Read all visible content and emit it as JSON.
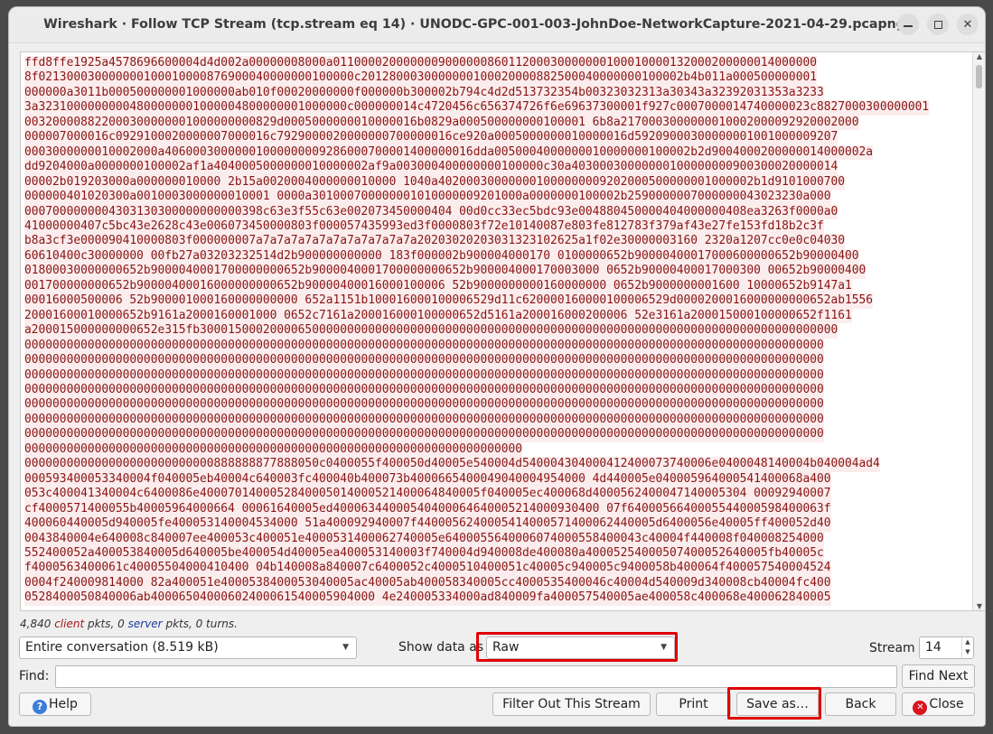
{
  "window": {
    "title": "Wireshark · Follow TCP Stream (tcp.stream eq 14) · UNODC-GPC-001-003-JohnDoe-NetworkCapture-2021-04-29.pcapng"
  },
  "stream": {
    "lines": [
      "ffd8ffe1925a4578696600004d4d002a00000008000a011000020000000900000086011200030000000100010000132000200000014000000",
      "8f021300030000000100010000876900040000000100000c2012800030000000100020000882500040000000100002b4b011a000500000001",
      "000000a3011b000500000001000000ab010f00020000000f000000b300002b794c4d2d513732354b00323032313a30343a32392031353a3233",
      "3a32310000000004800000001000004800000001000000c000000014c4720456c656374726f6e69637300001f927c0007000014740000023c8827000300000001",
      "003200008822000300000001000000000829d0005000000010000016b0829a000500000000100001 6b8a2170003000000010002000092920002000",
      "000007000016c0929100020000007000016c7929000020000000700000016ce920a0005000000010000016d59209000300000001001000009207",
      "0003000000010002000a40600030000001000000009286000700001400000016dda0050004000000010000000100002b2d9004000200000014000002a",
      "dd9204000a0000000100002af1a4040005000000010000002af9a003000400000000100000c30a40300030000000100000000900300020000014",
      "00002b019203000a000000010000 2b15a0020004000000010000 1040a402000300000001000000009202000500000001000002b1d9101000700",
      "000000401020300a0010003000000010001 0000a301000700000001010000009201000a0000000100002b2590000007000000043023230a000",
      "0007000000004303130300000000000398c63e3f55c63e002073450000404 00d0cc33ec5bdc93e004880450000404000000408ea3263f0000a0",
      "41000000407c5bc43e2628c43e006073450000803f000057435993ed3f0000803f72e10140087e803fe812783f379af43e27fe153fd18b2c3f",
      "b8a3cf3e000090410000803f000000007a7a7a7a7a7a7a7a7a7a7a7a20203020203031323102625a1f02e30000003160 2320a1207cc0e0c04030",
      "60610400c30000000 00fb27a03203232514d2b900000000000 183f000002b900004000170 0100000652b90000400017000600000652b90000400",
      "01800030000000652b9000040001700000000652b9000040001700000000652b900004000170003000 0652b90000400017000300 00652b90000400",
      "001700000000652b90000400016000000000652b90000400016000100006 52b9000000000160000000 0652b9000000001600 10000652b9147a1",
      "00016000500006 52b900001000160000000000 652a1151b100016000100006529d11c620000160000100006529d0000200016000000000652ab1556",
      "20001600010000652b9161a2000160001000 0652c7161a200016000100000652d5161a200016000200006 52e3161a200015000100000652f1161",
      "a200015000000000652e315fb3000150002000065000000000000000000000000000000000000000000000000000000000000000000000000000",
      "000000000000000000000000000000000000000000000000000000000000000000000000000000000000000000000000000000000000000000",
      "000000000000000000000000000000000000000000000000000000000000000000000000000000000000000000000000000000000000000000",
      "000000000000000000000000000000000000000000000000000000000000000000000000000000000000000000000000000000000000000000",
      "000000000000000000000000000000000000000000000000000000000000000000000000000000000000000000000000000000000000000000",
      "000000000000000000000000000000000000000000000000000000000000000000000000000000000000000000000000000000000000000000",
      "000000000000000000000000000000000000000000000000000000000000000000000000000000000000000000000000000000000000000000",
      "000000000000000000000000000000000000000000000000000000000000000000000000000000000000000000000000000000000000000000",
      "00000000000000000000000000000000000000000000000000000000000000000000000",
      "000000000000000000000000000888888877888050c0400055f400050d40005e540004d540004304000412400073740006e0400048140004b040004ad4",
      "000593400053340004f040005eb40004c640003fc400040b400073b4000665400049040004954000 4d440005e040005964000541400068a400",
      "053c400041340004c6400086e4000701400052840005014000521400064840005f040005ec400068d4000562400047140005304 00092940007",
      "cf4000571400055b40005964000664 00061640005ed40006344000540400064640005214000930400 07f6400056640005544000598400063f",
      "400060440005d940005fe400053140004534000 51a400092940007f4400056240005414000571400062440005d6400056e40005ff400052d40",
      "0043840004e640008c840007ee400053c400051e4000531400062740005e6400055640006074000558400043c40004f440008f040008254000",
      "552400052a400053840005d640005be400054d40005ea400053140003f740004d940008de400080a40005254000507400052640005fb40005c",
      "f4000563400061c40005504000410400 04b140008a840007c6400052c4000510400051c40005c940005c9400058b400064f400057540004524",
      "0004f240009814000 82a400051e4000538400053040005ac40005ab400058340005cc4000535400046c40004d540009d340008cb40004fc400",
      "0528400050840006ab40006504000602400061540005904000 4e240005334000ad840009fa400057540005ae400058c400068e400062840005"
    ]
  },
  "stats": {
    "client_count": "4,840",
    "client_word": "client",
    "mid": "pkts,",
    "server_count": "0",
    "server_word": "server",
    "tail": "pkts, 0 turns."
  },
  "controls": {
    "conversation": "Entire conversation (8.519 kB)",
    "show_data_label": "Show data as",
    "show_data_value": "Raw",
    "stream_label": "Stream",
    "stream_value": "14",
    "find_label": "Find:",
    "find_value": "",
    "find_next": "Find Next"
  },
  "buttons": {
    "help": "Help",
    "filter_out": "Filter Out This Stream",
    "print": "Print",
    "save_as": "Save as…",
    "back": "Back",
    "close": "Close"
  },
  "colors": {
    "client_text": "#8a1414",
    "client_bg": "#fbeded",
    "highlight": "#e00000"
  }
}
